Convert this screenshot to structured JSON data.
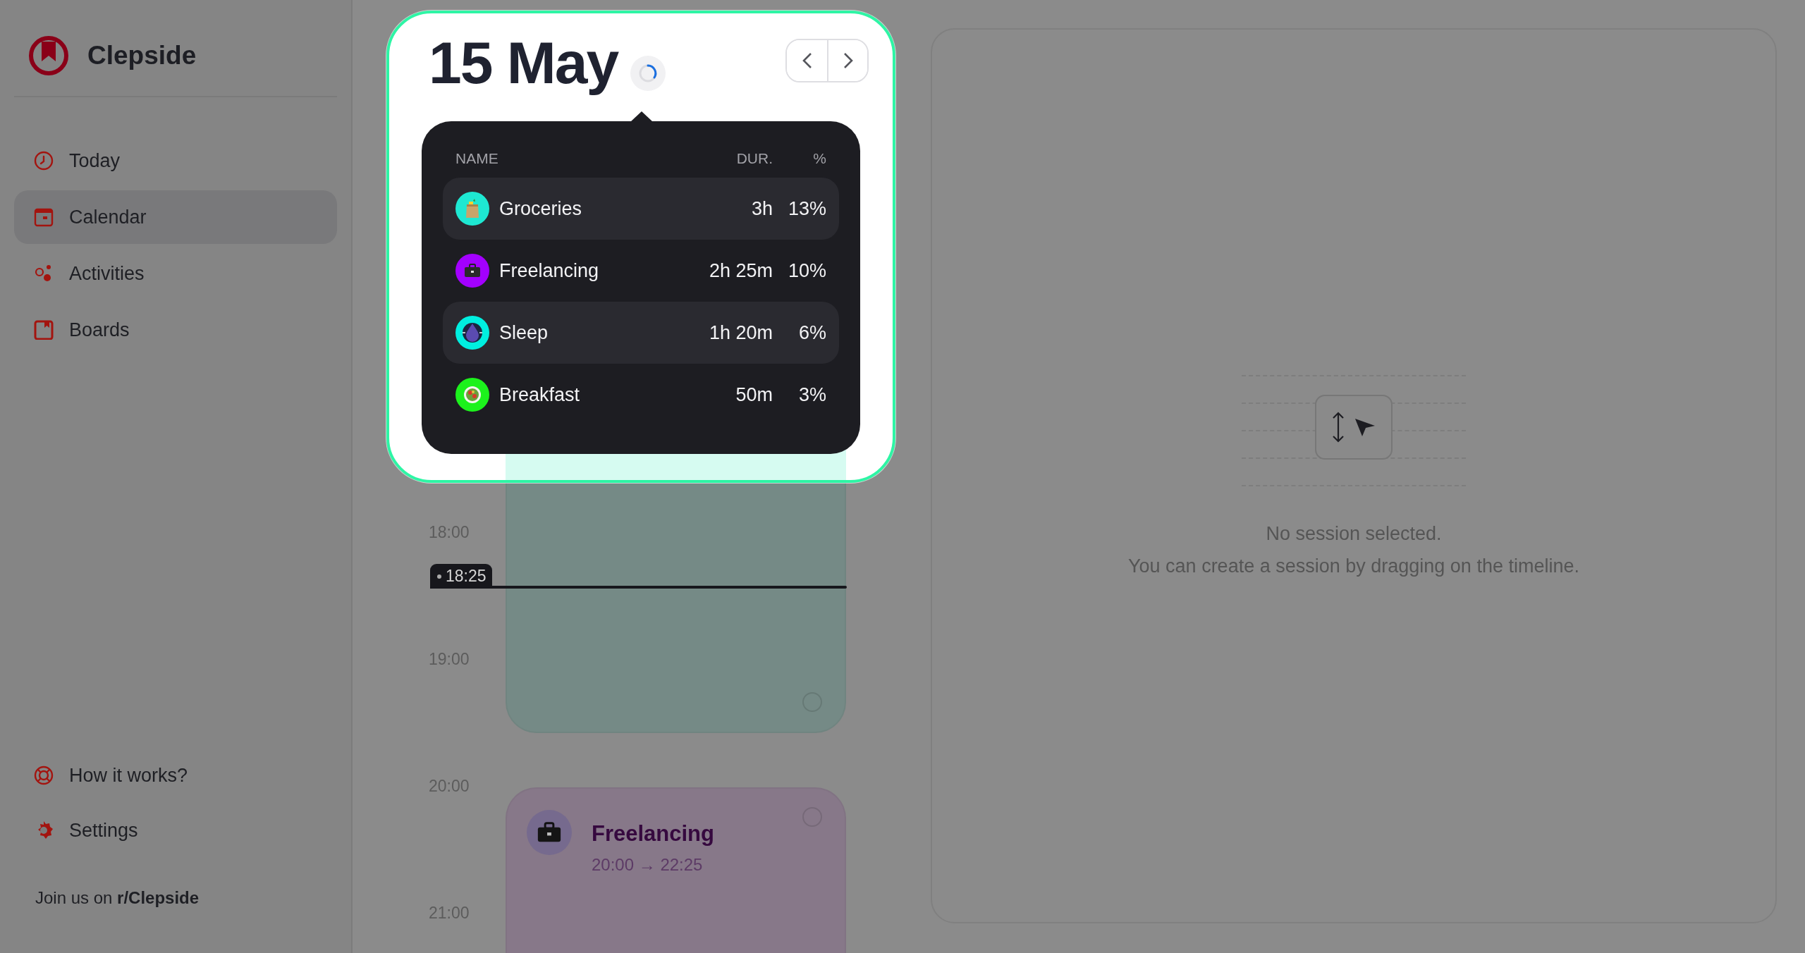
{
  "sidebar": {
    "brand": "Clepside",
    "nav": [
      {
        "label": "Today",
        "selected": false
      },
      {
        "label": "Calendar",
        "selected": true
      },
      {
        "label": "Activities",
        "selected": false
      },
      {
        "label": "Boards",
        "selected": false
      }
    ],
    "footer": [
      {
        "label": "How it works?"
      },
      {
        "label": "Settings"
      }
    ],
    "community": "Join us on **r/Clepside**"
  },
  "day_summary": {
    "title": "15 May",
    "columns": [
      "NAME",
      "DUR.",
      "%"
    ],
    "rows": [
      {
        "name": "Groceries",
        "duration": "3h",
        "percent": "13%",
        "color": "#1ee8d2"
      },
      {
        "name": "Freelancing",
        "duration": "2h 25m",
        "percent": "10%",
        "color": "#a300ff"
      },
      {
        "name": "Sleep",
        "duration": "1h 20m",
        "percent": "6%",
        "color": "#00efe0"
      },
      {
        "name": "Breakfast",
        "duration": "50m",
        "percent": "3%",
        "color": "#1cf21c"
      }
    ]
  },
  "timeline": {
    "hours": [
      "18:00",
      "19:00",
      "20:00",
      "21:00"
    ],
    "now": "18:25",
    "events": [
      {
        "color": "#758a86",
        "checked": false
      },
      {
        "title": "Freelancing",
        "time": "20:00 → 22:25",
        "color": "#877889",
        "checked": false
      }
    ]
  },
  "detail": {
    "messages": [
      "No session selected.",
      "You can create a session by dragging on the timeline."
    ]
  }
}
